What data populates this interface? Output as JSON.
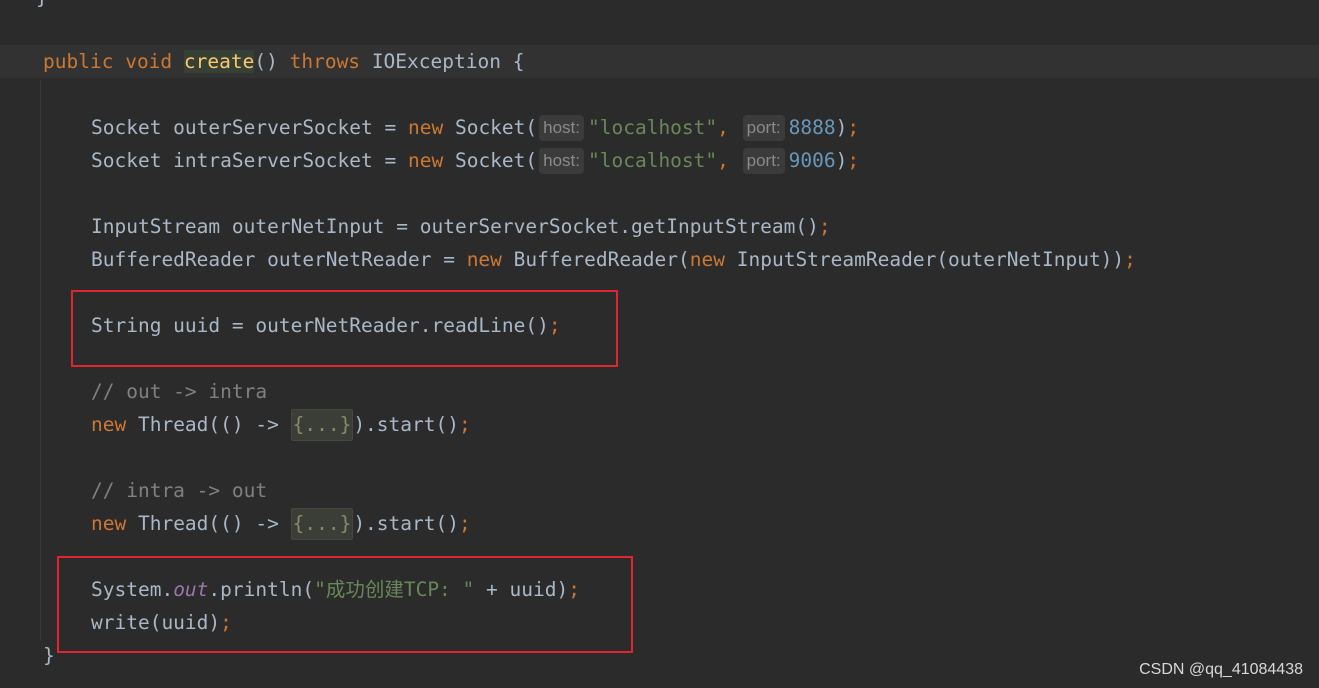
{
  "code": {
    "prev_brace": "}",
    "method": {
      "kw_public": "public",
      "kw_void": "void",
      "name": "create",
      "parens": "()",
      "kw_throws": "throws",
      "exception": "IOException",
      "open_brace": "{"
    },
    "socket1": {
      "decl": "Socket outerServerSocket = ",
      "kw_new": "new",
      "ctor": " Socket(",
      "hint_host": "host:",
      "host": "\"localhost\"",
      "comma": ",",
      "hint_port": "port:",
      "port": "8888",
      "close": ")",
      "semi": ";"
    },
    "socket2": {
      "decl": "Socket intraServerSocket = ",
      "kw_new": "new",
      "ctor": " Socket(",
      "hint_host": "host:",
      "host": "\"localhost\"",
      "comma": ",",
      "hint_port": "port:",
      "port": "9006",
      "close": ")",
      "semi": ";"
    },
    "input_line": {
      "text": "InputStream outerNetInput = outerServerSocket.getInputStream()",
      "semi": ";"
    },
    "reader_line": {
      "decl": "BufferedReader outerNetReader = ",
      "kw_new1": "new",
      "ctor1": " BufferedReader(",
      "kw_new2": "new",
      "ctor2": " InputStreamReader(outerNetInput))",
      "semi": ";"
    },
    "uuid_line": {
      "text": "String uuid = outerNetReader.readLine()",
      "semi": ";"
    },
    "comment1": "// out -> intra",
    "thread1": {
      "kw_new": "new",
      "pre": " Thread(() -> ",
      "fold": "{...}",
      "post": ").start()",
      "semi": ";"
    },
    "comment2": "// intra -> out",
    "thread2": {
      "kw_new": "new",
      "pre": " Thread(() -> ",
      "fold": "{...}",
      "post": ").start()",
      "semi": ";"
    },
    "println_line": {
      "obj": "System.",
      "field": "out",
      "call": ".println(",
      "str": "\"成功创建TCP: \"",
      "rest": " + uuid)",
      "semi": ";"
    },
    "write_line": {
      "text": "write(uuid)",
      "semi": ";"
    },
    "close_brace": "}"
  },
  "watermark": "CSDN @qq_41084438",
  "colors": {
    "background": "#2b2b2b",
    "keyword": "#cc7832",
    "string": "#6a8759",
    "number": "#6897bb",
    "comment": "#808080",
    "method_def": "#ffc66d",
    "static_field": "#9876aa",
    "highlight_box": "#e0252f"
  }
}
